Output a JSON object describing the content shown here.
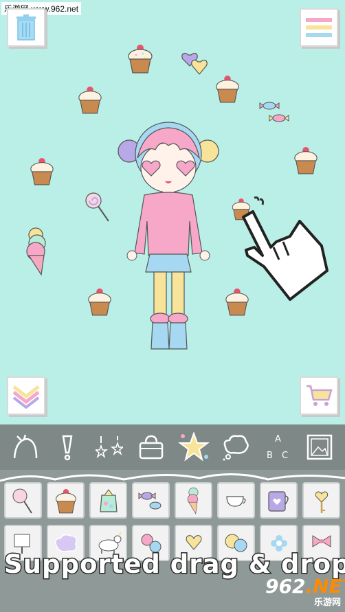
{
  "watermark": {
    "text": "乐游网 www.962.net"
  },
  "toolbar": {
    "trash_icon": "trash-icon",
    "menu_icon": "hamburger-menu-icon",
    "collapse_icon": "chevron-down-double-icon",
    "shop_icon": "shopping-cart-icon"
  },
  "categories": [
    {
      "name": "hair",
      "icon": "hair-ribbon-icon"
    },
    {
      "name": "expression",
      "icon": "exclamation-icon"
    },
    {
      "name": "earrings",
      "icon": "earrings-icon"
    },
    {
      "name": "bag",
      "icon": "handbag-icon"
    },
    {
      "name": "effects",
      "icon": "sparkle-icon"
    },
    {
      "name": "speech",
      "icon": "thought-bubble-icon"
    },
    {
      "name": "text",
      "icon": "abc-letters-icon",
      "letters": [
        "A",
        "B",
        "C"
      ]
    },
    {
      "name": "background",
      "icon": "picture-frame-icon"
    }
  ],
  "items": [
    {
      "name": "lollipop",
      "icon": "lollipop-icon"
    },
    {
      "name": "cupcake",
      "icon": "cupcake-icon"
    },
    {
      "name": "candy-bag",
      "icon": "candy-bag-icon"
    },
    {
      "name": "candy",
      "icon": "wrapped-candy-icon"
    },
    {
      "name": "ice-cream",
      "icon": "ice-cream-icon"
    },
    {
      "name": "teacup",
      "icon": "teacup-icon"
    },
    {
      "name": "mug",
      "icon": "heart-mug-icon"
    },
    {
      "name": "key",
      "icon": "heart-key-icon"
    },
    {
      "name": "sign",
      "icon": "sign-icon"
    },
    {
      "name": "star-cloud",
      "icon": "star-cloud-icon"
    },
    {
      "name": "unicorn",
      "icon": "unicorn-icon"
    },
    {
      "name": "candies",
      "icon": "candies-icon"
    },
    {
      "name": "heart-sign",
      "icon": "heart-sign-icon"
    },
    {
      "name": "bubbles",
      "icon": "bubbles-icon"
    },
    {
      "name": "flower",
      "icon": "flower-icon"
    },
    {
      "name": "bow",
      "icon": "bow-icon"
    }
  ],
  "caption": {
    "text": "Supported drag & drop"
  },
  "logo": {
    "big": "962",
    "suffix": ".NET",
    "sub": "乐游网"
  },
  "colors": {
    "canvas": "#b9efe6",
    "catbar": "#7e8886",
    "itemgrid": "#8f9997",
    "accent_pink": "#f7a8c8",
    "accent_yellow": "#f7e49a",
    "accent_blue": "#a6d8f2"
  }
}
